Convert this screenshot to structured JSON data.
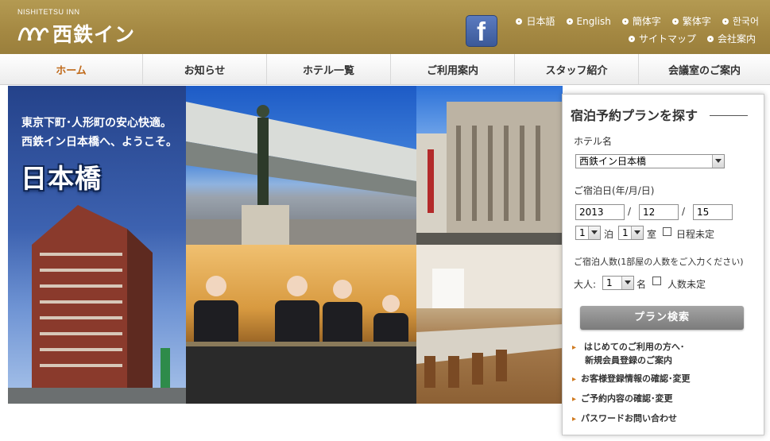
{
  "header": {
    "brand_small": "NISHITETSU INN",
    "brand_name": "西鉄イン",
    "facebook_glyph": "f",
    "languages": [
      "日本語",
      "English",
      "簡体字",
      "繁体字",
      "한국어"
    ],
    "utility_links": [
      "サイトマップ",
      "会社案内"
    ]
  },
  "nav": {
    "items": [
      "ホーム",
      "お知らせ",
      "ホテル一覧",
      "ご利用案内",
      "スタッフ紹介",
      "会議室のご案内"
    ]
  },
  "hero": {
    "tagline_1": "東京下町･人形町の安心快適。",
    "tagline_2": "西鉄イン日本橋へ、ようこそ。",
    "place": "日本橋"
  },
  "search": {
    "title": "宿泊予約プランを探す",
    "hotel_label": "ホテル名",
    "hotel_value": "西鉄イン日本橋",
    "date_label": "ご宿泊日(年/月/日)",
    "year": "2013",
    "month": "12",
    "day": "15",
    "date_sep": "/",
    "nights_value": "1",
    "nights_unit": "泊",
    "rooms_value": "1",
    "rooms_unit": "室",
    "date_undecided": "日程未定",
    "guests_label": "ご宿泊人数(1部屋の人数をご入力ください)",
    "adults_label": "大人:",
    "adults_value": "1",
    "adults_unit": "名",
    "guests_undecided": "人数未定",
    "submit": "プラン検索",
    "links": [
      "はじめてのご利用の方へ･",
      "新規会員登録のご案内",
      "お客様登録情報の確認･変更",
      "ご予約内容の確認･変更",
      "パスワードお問い合わせ"
    ]
  },
  "colors": {
    "header_gold": "#a48842",
    "nav_active": "#c06a1a",
    "hero_blue": "#24428a",
    "link_bullet": "#d07a20",
    "facebook_blue": "#3b5998"
  }
}
